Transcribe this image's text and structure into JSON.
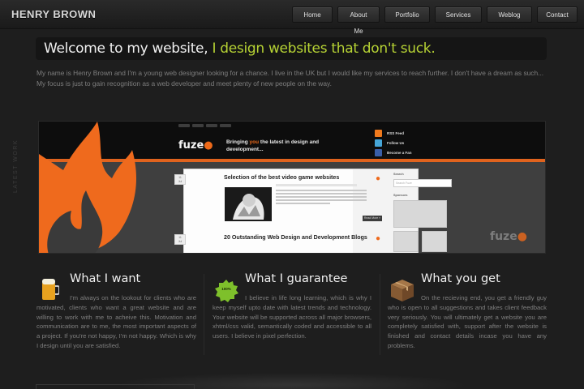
{
  "header": {
    "logo": "HENRY BROWN",
    "nav": [
      "Home",
      "About Me",
      "Portfolio",
      "Services",
      "Weblog",
      "Contact"
    ]
  },
  "welcome": {
    "lead": "Welcome to my website, ",
    "highlight": "I design websites that don't suck."
  },
  "intro": "My name is Henry Brown and I'm a young web designer looking for a chance. I live in the UK but I would like my services to reach further. I don't have a dream as such... My focus is just to gain recognition as a web developer and meet plenty of new people on the way.",
  "showcase": {
    "label": "LATEST WORK",
    "site": {
      "logo": "fuze",
      "tagline_a": "Bringing ",
      "tagline_hl": "you",
      "tagline_b": " the latest in design and development...",
      "social": [
        "RSS Feed",
        "Follow Us",
        "Become a Fan"
      ],
      "post1_title": "Selection of the best video game websites",
      "post2_title": "20 Outstanding Web Design and Development Blogs",
      "date_day": "11",
      "date_month": "Jul",
      "read_more": "Read More »",
      "search_label": "Search",
      "search_placeholder": "Search Fuze",
      "sponsors_label": "Sponsors",
      "watermark": "fuze"
    }
  },
  "columns": [
    {
      "title": "What I want",
      "text": "I'm always on the lookout for clients who are motivated, clients who want a great website and are willing to work with me to acheive this. Motivation and communication are to me, the most important aspects of a project. If you're not happy, I'm not happy. Which is why I design until you are satisfied."
    },
    {
      "title": "What I guarantee",
      "badge": "100% guaranteed",
      "text": "I believe in life long learning, which is why I keep myself upto date with latest trends and technology. Your website will be supported across all major browsers, xhtml/css valid, semantically coded and accessible to all users. I believe in pixel perfection."
    },
    {
      "title": "What you get",
      "text": "On the recieving end, you get a friendly guy who is open to all suggestions and takes client feedback very seriously. You will ultimately get a website you are completely satisfied with, support after the website is finished and contact details incase you have any problems."
    }
  ],
  "colors": {
    "accent_green": "#b6d234",
    "accent_orange": "#ee6a1a",
    "background": "#1e1e1e"
  }
}
